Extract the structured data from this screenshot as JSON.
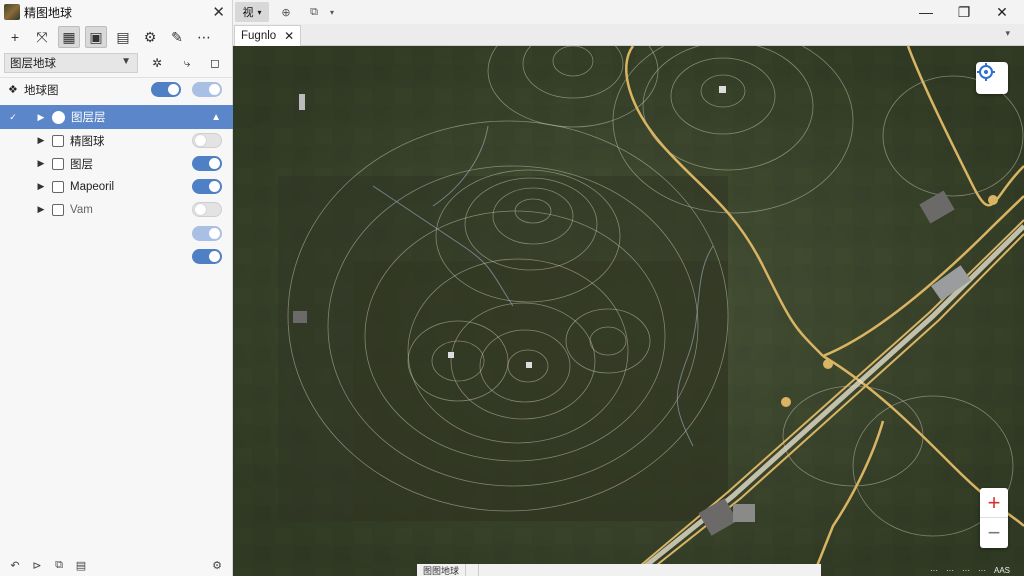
{
  "app": {
    "title": "精图地球",
    "close": "✕"
  },
  "toolbar": {
    "items": [
      {
        "icon": "plus-icon",
        "glyph": "+"
      },
      {
        "icon": "move-icon",
        "glyph": "⤧"
      },
      {
        "icon": "grid-icon",
        "glyph": "▦"
      },
      {
        "icon": "save-icon",
        "glyph": "▣"
      },
      {
        "icon": "table-icon",
        "glyph": "▤"
      },
      {
        "icon": "settings-icon",
        "glyph": "⚙"
      },
      {
        "icon": "edit-icon",
        "glyph": "✎"
      },
      {
        "icon": "more-icon",
        "glyph": "⋯"
      }
    ]
  },
  "layer_select": {
    "value": "图层地球",
    "tools": [
      "✲",
      "⤷",
      "◻"
    ]
  },
  "tree": {
    "root": {
      "label": "地球图"
    },
    "selected": {
      "label": "图层层"
    },
    "children": [
      {
        "label": "精图球",
        "on": false
      },
      {
        "label": "图层",
        "on": true
      },
      {
        "label": "Mapeoril",
        "on": true
      },
      {
        "label": "Vam",
        "on": false
      }
    ],
    "extra_toggles": [
      "dim",
      "on"
    ]
  },
  "bottom_tools": [
    "↶",
    "⊳",
    "⧉",
    "▤",
    "⚙"
  ],
  "topbar": {
    "first_tab": "视",
    "icons": [
      "⊕",
      "⧉"
    ],
    "win": [
      "—",
      "❐",
      "✕"
    ]
  },
  "doc_tab": {
    "label": "Fugnlo",
    "close": "✕"
  },
  "status": {
    "segments": [
      "图图地球",
      "",
      ""
    ],
    "right": [
      "···",
      "···",
      "···",
      "···",
      "AAS"
    ]
  },
  "colors": {
    "accent": "#5b86c9",
    "road": "#d9b463",
    "zoom_in": "#d9312a"
  }
}
